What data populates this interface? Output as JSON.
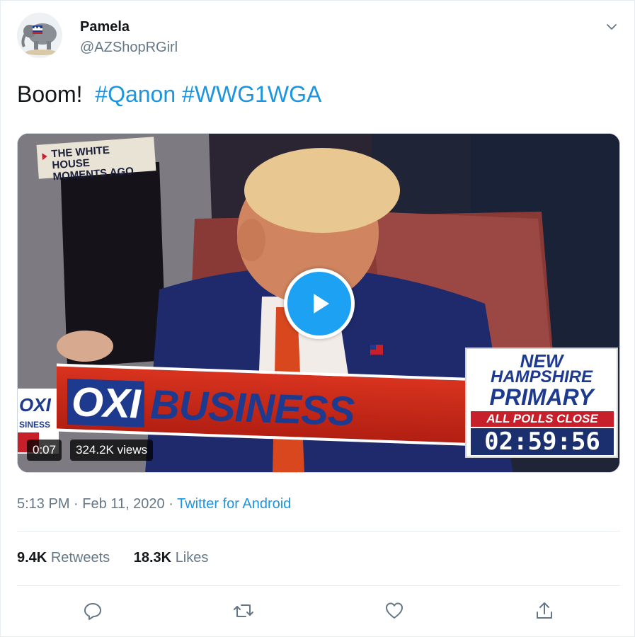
{
  "user": {
    "name": "Pamela",
    "handle": "@AZShopRGirl",
    "avatar_icon": "republican-elephant-avatar"
  },
  "tweet": {
    "text_prefix": "Boom!",
    "hashtags": [
      "#Qanon",
      "#WWG1WGA"
    ]
  },
  "media": {
    "overlay_banner_line1": "THE WHITE HOUSE",
    "overlay_banner_line2": "MOMENTS AGO",
    "fox_logo_line1": "OXI",
    "fox_logo_line2": "SINESS",
    "business_fox": "OXI",
    "business_word": "BUSINESS",
    "nh_line1": "NEW",
    "nh_line2": "HAMPSHIRE",
    "nh_line3": "PRIMARY",
    "nh_polls": "ALL POLLS CLOSE",
    "nh_clock": "02:59:56",
    "elapsed": "0:07",
    "views": "324.2K views",
    "play_icon": "play-icon"
  },
  "meta": {
    "time": "5:13 PM",
    "separator": "·",
    "date": "Feb 11, 2020",
    "source": "Twitter for Android"
  },
  "stats": {
    "retweets_count": "9.4K",
    "retweets_label": "Retweets",
    "likes_count": "18.3K",
    "likes_label": "Likes"
  },
  "actions": [
    "reply-icon",
    "retweet-icon",
    "like-icon",
    "share-icon"
  ],
  "colors": {
    "link_blue": "#1b95e0",
    "play_blue": "#1da1f2",
    "muted_gray": "#657786",
    "text_dark": "#14171a"
  }
}
